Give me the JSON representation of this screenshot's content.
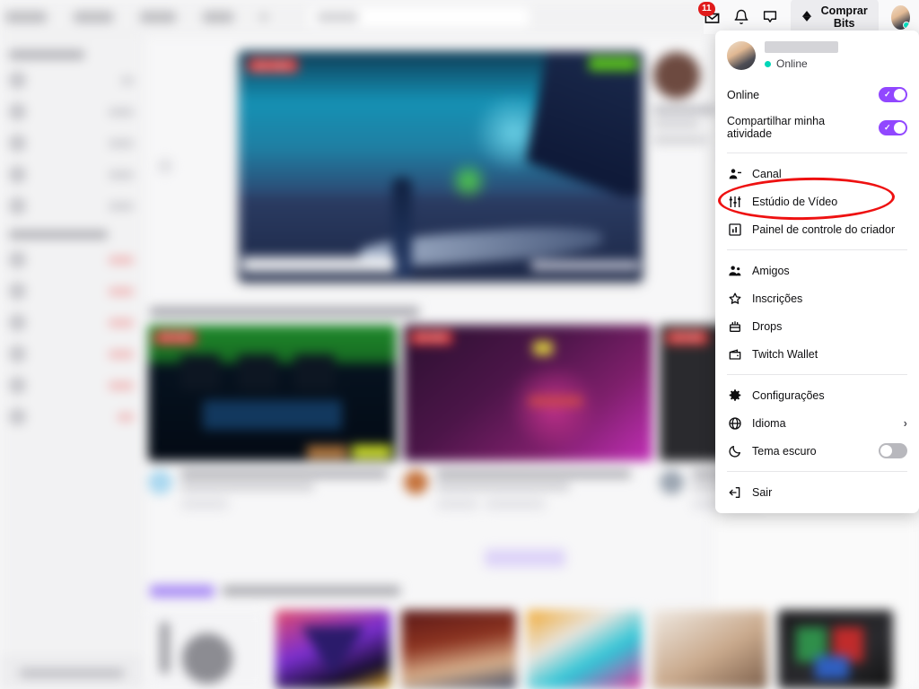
{
  "topbar": {
    "inbox_icon": "inbox-icon",
    "notification_badge": "11",
    "bell_icon": "bell-icon",
    "whispers_icon": "chat-bubble-icon",
    "bits_label": "Comprar Bits",
    "bits_icon": "bits-diamond-icon",
    "avatar": "user-avatar"
  },
  "menu": {
    "account": {
      "display_name": "",
      "status": "Online",
      "avatar": "user-avatar"
    },
    "toggles": [
      {
        "label": "Online",
        "state": "on",
        "icon": "toggle-switch"
      },
      {
        "label": "Compartilhar minha atividade",
        "state": "on",
        "icon": "toggle-switch"
      }
    ],
    "group_creator": [
      {
        "label": "Canal",
        "icon": "person-add-icon"
      },
      {
        "label": "Estúdio de Vídeo",
        "icon": "sliders-icon"
      },
      {
        "label": "Painel de controle do criador",
        "icon": "dashboard-chart-icon"
      }
    ],
    "group_social": [
      {
        "label": "Amigos",
        "icon": "friends-icon"
      },
      {
        "label": "Inscrições",
        "icon": "star-icon"
      },
      {
        "label": "Drops",
        "icon": "drops-chest-icon"
      },
      {
        "label": "Twitch Wallet",
        "icon": "wallet-icon"
      }
    ],
    "group_settings": [
      {
        "label": "Configurações",
        "icon": "gear-icon"
      },
      {
        "label": "Idioma",
        "icon": "globe-icon",
        "chevron": "›"
      },
      {
        "label": "Tema escuro",
        "icon": "moon-icon",
        "state": "off"
      }
    ],
    "group_logout": [
      {
        "label": "Sair",
        "icon": "logout-icon"
      }
    ]
  },
  "background": {
    "hero_live_badge": "AO VIVO",
    "card_live_badge": "AO VIVO"
  },
  "annotation": {
    "shape": "ellipse",
    "color": "#ee1111",
    "targets": "Painel de controle do criador"
  },
  "colors": {
    "accent_purple": "#9147ff",
    "live_red": "#e03b3b",
    "annotation_red": "#ee1111",
    "online_teal": "#00d6b8",
    "badge_red": "#e01b1b"
  }
}
